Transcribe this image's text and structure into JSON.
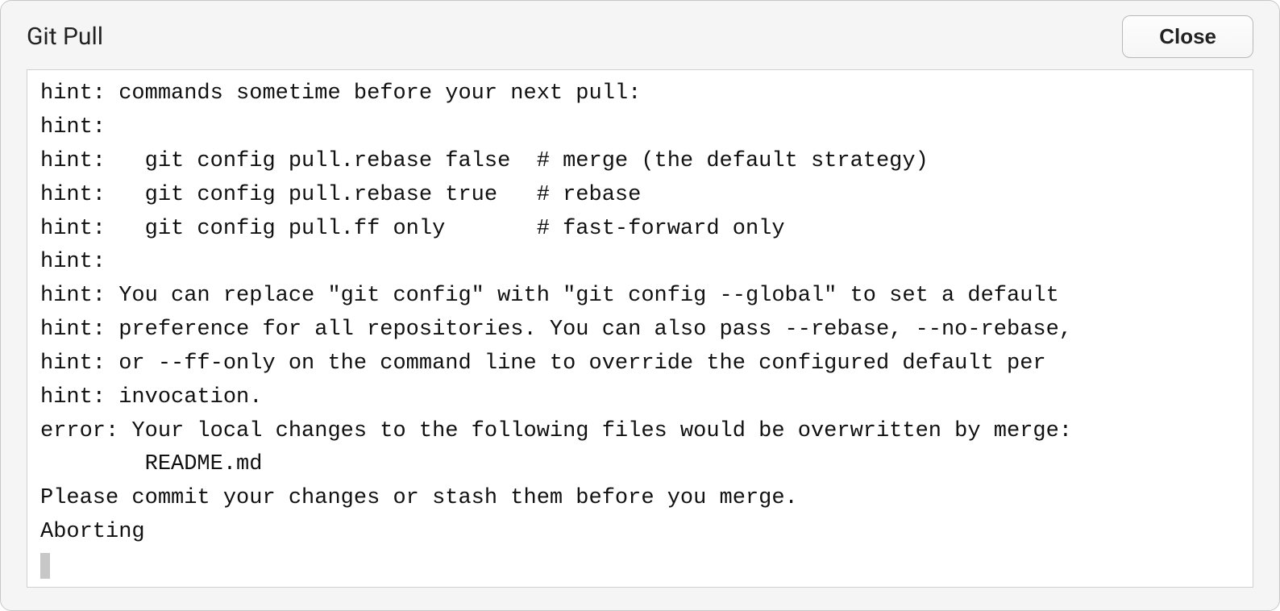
{
  "dialog": {
    "title": "Git Pull",
    "close_label": "Close",
    "output_lines": [
      "hint: commands sometime before your next pull:",
      "hint:",
      "hint:   git config pull.rebase false  # merge (the default strategy)",
      "hint:   git config pull.rebase true   # rebase",
      "hint:   git config pull.ff only       # fast-forward only",
      "hint:",
      "hint: You can replace \"git config\" with \"git config --global\" to set a default",
      "hint: preference for all repositories. You can also pass --rebase, --no-rebase,",
      "hint: or --ff-only on the command line to override the configured default per",
      "hint: invocation.",
      "error: Your local changes to the following files would be overwritten by merge:",
      "\tREADME.md",
      "Please commit your changes or stash them before you merge.",
      "Aborting"
    ]
  }
}
